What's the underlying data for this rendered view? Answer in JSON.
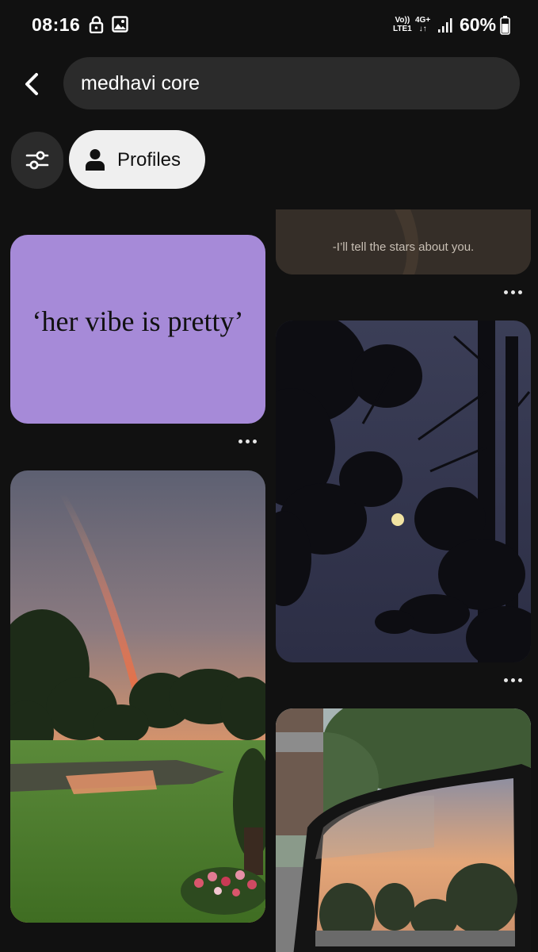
{
  "status_bar": {
    "time": "08:16",
    "network_line1": "Vo))",
    "network_line2": "LTE1",
    "network_type": "4G+",
    "network_arrows": "↓↑",
    "battery": "60%",
    "icons": [
      "lock-icon",
      "image-icon",
      "signal-icon",
      "battery-icon"
    ]
  },
  "search": {
    "query": "medhavi core"
  },
  "filters": {
    "filter_icon": "sliders-icon",
    "profiles_label": "Profiles",
    "profiles_icon": "person-icon"
  },
  "pins": {
    "purple": {
      "text": "‘her vibe is pretty’"
    },
    "stars": {
      "text": "-I’ll tell the stars about you."
    }
  },
  "colors": {
    "background": "#111111",
    "field": "#2b2b2b",
    "chip_active": "#efefef",
    "purple_pin": "#a68ad8"
  }
}
